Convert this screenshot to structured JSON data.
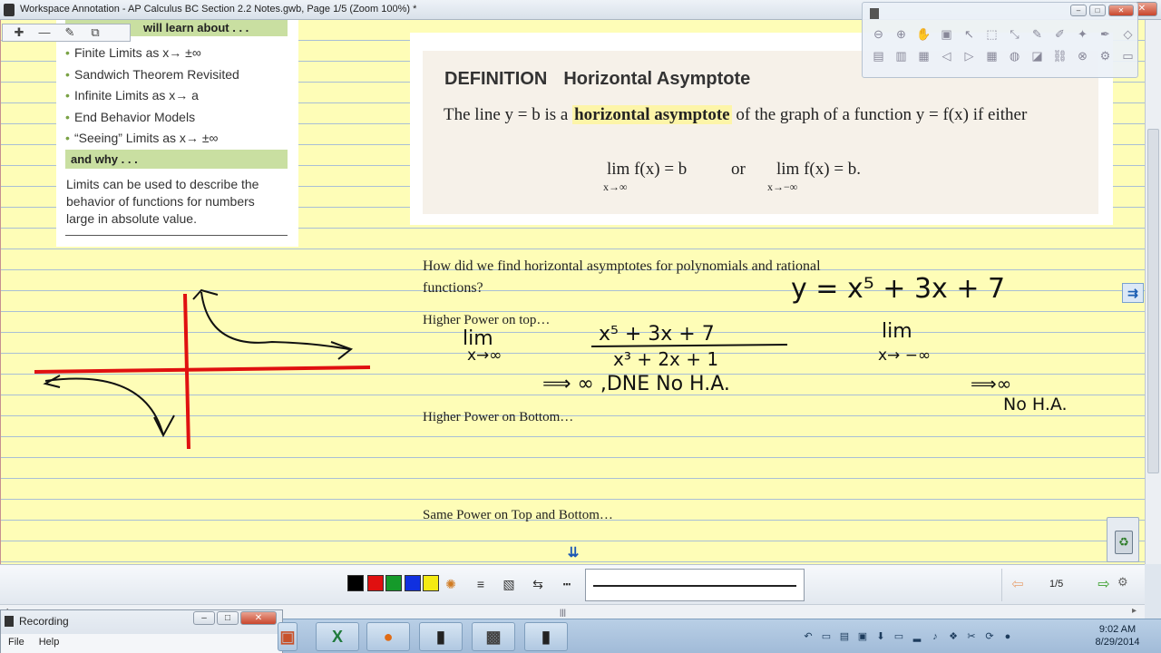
{
  "window": {
    "title": "Workspace Annotation - AP Calculus BC Section 2.2 Notes.gwb, Page 1/5  (Zoom 100%) *",
    "min": "–",
    "max": "□",
    "close": "✕"
  },
  "learn": {
    "header": "will learn about . . .",
    "items": [
      "Finite Limits as x→ ±∞",
      "Sandwich Theorem Revisited",
      "Infinite Limits as x→ a",
      "End Behavior Models",
      "“Seeing” Limits as x→ ±∞"
    ],
    "why_header": "and why . . .",
    "why_text": "Limits can be used to describe the behavior of functions for numbers large in absolute value."
  },
  "mini_toolbar": {
    "icons": [
      "✚",
      "—",
      "✎",
      "⧉"
    ]
  },
  "definition": {
    "keyword": "DEFINITION",
    "title": "Horizontal Asymptote",
    "body_before": "The line y = b is a ",
    "body_highlight": "horizontal asymptote",
    "body_after": " of the graph of a function y = f(x) if either",
    "lim1": "lim f(x) = b",
    "lim1_sub": "x→∞",
    "or": "or",
    "lim2": "lim f(x) = b.",
    "lim2_sub": "x→−∞"
  },
  "notes": {
    "question": "How did we find horizontal asymptotes for polynomials and rational",
    "question2": "functions?",
    "higher_top": "Higher Power on top…",
    "higher_bottom": "Higher Power on Bottom…",
    "same_power": "Same Power on Top and Bottom…"
  },
  "handwriting": {
    "eq": "y = x⁵ + 3x + 7",
    "lim_left": "lim",
    "lim_left_sub": "x→∞",
    "fraction_num": "x⁵ + 3x + 7",
    "fraction_den": "x³ + 2x + 1",
    "result": "⟹ ∞ ,DNE  No H.A.",
    "lim_right": "lim",
    "lim_right_sub": "x→ −∞",
    "result_right": "⟹∞",
    "result_right2": "No H.A."
  },
  "bottom_toolbar": {
    "colors": [
      "#000000",
      "#e01010",
      "#159a2a",
      "#1030e0",
      "#f4ea12"
    ],
    "page": "1/5"
  },
  "recording": {
    "title": "Recording",
    "menu": [
      "File",
      "Help"
    ]
  },
  "taskbar": {
    "time": "9:02 AM",
    "date": "8/29/2014"
  }
}
